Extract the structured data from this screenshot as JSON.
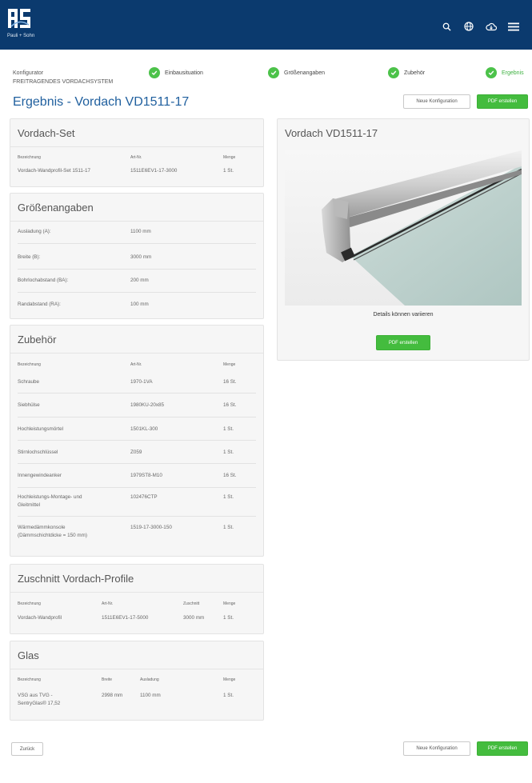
{
  "brand": {
    "logo_text": "RS",
    "company": "Pauli + Sohn",
    "bg_color": "#0b3a6e"
  },
  "topbar_icons": [
    "search-icon",
    "globe-icon",
    "cloud-download-icon",
    "menu-icon"
  ],
  "configurator": {
    "label": "Konfigurator",
    "system": "FREITRAGENDES VORDACHSYSTEM"
  },
  "steps": [
    {
      "label": "Einbausituation",
      "done": true
    },
    {
      "label": "Größenangaben",
      "done": true
    },
    {
      "label": "Zubehör",
      "done": true
    },
    {
      "label": "Ergebnis",
      "done": true,
      "active": true
    }
  ],
  "page_title": "Ergebnis - Vordach VD1511-17",
  "buttons": {
    "new_config": "Neue Konfiguration",
    "pdf": "PDF erstellen",
    "back": "Zurück"
  },
  "accent_green": "#44bc3e",
  "vordach_set": {
    "title": "Vordach-Set",
    "headers": [
      "Bezeichnung",
      "Art-Nr.",
      "Menge"
    ],
    "rows": [
      [
        "Vordach-Wandprofil-Set 1511-17",
        "1511E6EV1-17-3000",
        "1 St."
      ]
    ]
  },
  "groessen": {
    "title": "Größenangaben",
    "rows": [
      [
        "Ausladung (A):",
        "1100 mm"
      ],
      [
        "Breite (B):",
        "3000 mm"
      ],
      [
        "Bohrlochabstand (BA):",
        "200 mm"
      ],
      [
        "Randabstand (RA):",
        "100 mm"
      ]
    ]
  },
  "zubehoer": {
    "title": "Zubehör",
    "headers": [
      "Bezeichnung",
      "Art-Nr.",
      "Menge"
    ],
    "rows": [
      [
        "Schraube",
        "1970-1VA",
        "16 St."
      ],
      [
        "Siebhülse",
        "1980KU-20x85",
        "16 St."
      ],
      [
        "Hochleistungsmörtel",
        "1501KL-300",
        "1 St."
      ],
      [
        "Stirnlochschlüssel",
        "Z059",
        "1 St."
      ],
      [
        "Innengewindeanker",
        "1979ST8-M10",
        "16 St."
      ],
      [
        "Hochleistungs-Montage- und\nGleitmittel",
        "102476CTP",
        "1 St."
      ],
      [
        "Wärmedämmkonsole\n(Dämmschichtdicke = 150 mm)",
        "1519-17-3000-150",
        "1 St."
      ]
    ]
  },
  "zuschnitt": {
    "title": "Zuschnitt Vordach-Profile",
    "headers": [
      "Bezeichnung",
      "Art-Nr.",
      "Zuschnitt",
      "Menge"
    ],
    "rows": [
      [
        "Vordach-Wandprofil",
        "1511E6EV1-17-5000",
        "3000 mm",
        "1 St."
      ]
    ]
  },
  "glas": {
    "title": "Glas",
    "headers": [
      "Bezeichnung",
      "Breite",
      "Ausladung",
      "Menge"
    ],
    "rows": [
      [
        "VSG aus TVG -\nSentryGlas® 17,52",
        "2998 mm",
        "1100 mm",
        "1 St."
      ]
    ]
  },
  "preview": {
    "title": "Vordach VD1511-17",
    "caption": "Details können variieren"
  }
}
